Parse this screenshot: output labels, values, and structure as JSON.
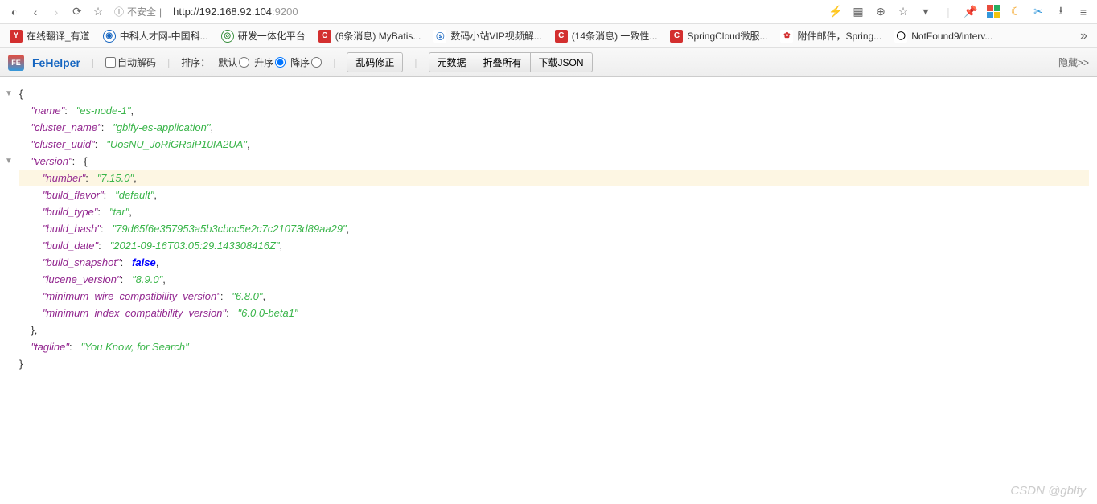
{
  "browser": {
    "security_label": "不安全",
    "url_host": "http://192.168.92.104",
    "url_port": ":9200"
  },
  "bookmarks": [
    {
      "icon_class": "bm-y",
      "icon_text": "Y",
      "label": "在线翻译_有道"
    },
    {
      "icon_class": "bm-zk",
      "icon_text": "◉",
      "label": "中科人才网-中国科..."
    },
    {
      "icon_class": "bm-rd",
      "icon_text": "◎",
      "label": "研发一体化平台"
    },
    {
      "icon_class": "bm-c",
      "icon_text": "C",
      "label": "(6条消息) MyBatis..."
    },
    {
      "icon_class": "bm-sm",
      "icon_text": "ⓢ",
      "label": "数码小站VIP视频解..."
    },
    {
      "icon_class": "bm-c",
      "icon_text": "C",
      "label": "(14条消息) 一致性..."
    },
    {
      "icon_class": "bm-c",
      "icon_text": "C",
      "label": "SpringCloud微服..."
    },
    {
      "icon_class": "bm-mail",
      "icon_text": "✿",
      "label": "附件邮件，Spring..."
    },
    {
      "icon_class": "bm-gh",
      "icon_text": "◯",
      "label": "NotFound9/interv..."
    }
  ],
  "toolbar": {
    "app_title": "FeHelper",
    "auto_decode_label": "自动解码",
    "sort_label": "排序：",
    "sort_default": "默认",
    "sort_asc": "升序",
    "sort_desc": "降序",
    "btn_fix_encoding": "乱码修正",
    "btn_metadata": "元数据",
    "btn_fold_all": "折叠所有",
    "btn_download": "下载JSON",
    "btn_hide": "隐藏>>"
  },
  "json_lines": [
    {
      "indent": 0,
      "marker": "▼",
      "key": null,
      "val": null,
      "pre": "{",
      "post": ""
    },
    {
      "indent": 1,
      "key": "name",
      "val": "es-node-1",
      "type": "str",
      "post": ","
    },
    {
      "indent": 1,
      "key": "cluster_name",
      "val": "gblfy-es-application",
      "type": "str",
      "post": ","
    },
    {
      "indent": 1,
      "key": "cluster_uuid",
      "val": "UosNU_JoRiGRaiP10IA2UA",
      "type": "str",
      "post": ","
    },
    {
      "indent": 1,
      "marker": "▼",
      "key": "version",
      "val": null,
      "pre": "{",
      "post": ""
    },
    {
      "indent": 2,
      "key": "number",
      "val": "7.15.0",
      "type": "str",
      "post": ",",
      "hilite": true
    },
    {
      "indent": 2,
      "key": "build_flavor",
      "val": "default",
      "type": "str",
      "post": ","
    },
    {
      "indent": 2,
      "key": "build_type",
      "val": "tar",
      "type": "str",
      "post": ","
    },
    {
      "indent": 2,
      "key": "build_hash",
      "val": "79d65f6e357953a5b3cbcc5e2c7c21073d89aa29",
      "type": "str",
      "post": ","
    },
    {
      "indent": 2,
      "key": "build_date",
      "val": "2021-09-16T03:05:29.143308416Z",
      "type": "str",
      "post": ","
    },
    {
      "indent": 2,
      "key": "build_snapshot",
      "val": "false",
      "type": "bool",
      "post": ","
    },
    {
      "indent": 2,
      "key": "lucene_version",
      "val": "8.9.0",
      "type": "str",
      "post": ","
    },
    {
      "indent": 2,
      "key": "minimum_wire_compatibility_version",
      "val": "6.8.0",
      "type": "str",
      "post": ","
    },
    {
      "indent": 2,
      "key": "minimum_index_compatibility_version",
      "val": "6.0.0-beta1",
      "type": "str",
      "post": ""
    },
    {
      "indent": 1,
      "key": null,
      "val": null,
      "pre": "},",
      "post": ""
    },
    {
      "indent": 1,
      "key": "tagline",
      "val": "You Know, for Search",
      "type": "str",
      "post": ""
    },
    {
      "indent": 0,
      "key": null,
      "val": null,
      "pre": "}",
      "post": ""
    }
  ],
  "watermark": "CSDN @gblfy"
}
